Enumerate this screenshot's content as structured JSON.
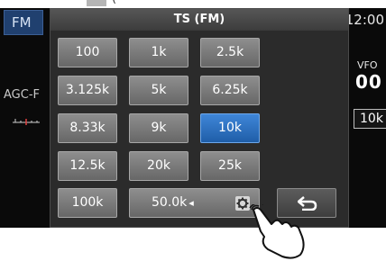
{
  "top_caption": "(",
  "background": {
    "mode": "FM",
    "clock": "12:00",
    "agc": "AGC-F",
    "vfo": "VFO",
    "frequency": "00",
    "ts_badge": "10k"
  },
  "dialog": {
    "title": "TS (FM)",
    "steps": [
      [
        "100",
        "1k",
        "2.5k"
      ],
      [
        "3.125k",
        "5k",
        "6.25k"
      ],
      [
        "8.33k",
        "9k",
        "10k"
      ],
      [
        "12.5k",
        "20k",
        "25k"
      ]
    ],
    "selected_step": "10k",
    "bottom_left": "100k",
    "bottom_middle": "50.0k",
    "arrow_glyph": "◂"
  },
  "icons": [
    "gear-icon",
    "back-arrow-icon",
    "hand-pointer-icon",
    "s-meter-icon"
  ],
  "colors": {
    "selected": "#2a72c6",
    "button": "#7a7a7a",
    "mode_button": "#20406f"
  }
}
